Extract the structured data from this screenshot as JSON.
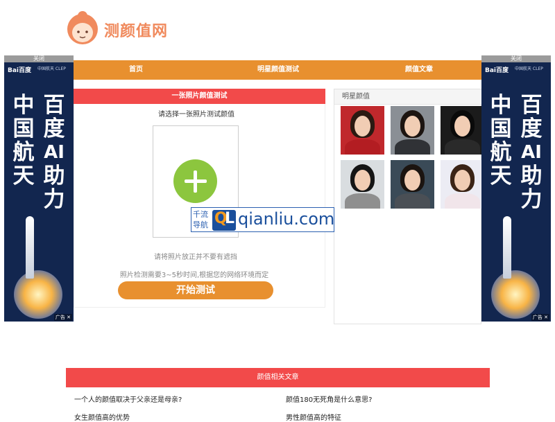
{
  "logo": {
    "text": "测颜值网"
  },
  "nav": {
    "items": [
      "首页",
      "明星颜值测试",
      "颜值文章"
    ]
  },
  "test": {
    "header": "一张照片颜值测试",
    "subtitle": "请选择一张照片测试颜值",
    "hint_position": "请将照片放正并不要有遮挡",
    "hint_time": "照片检测需要3~5秒时间,根据您的网络环境而定",
    "start_button": "开始测试"
  },
  "stars": {
    "header": "明星颜值",
    "thumbs": [
      {
        "name": "star-1",
        "bg": "#c0282c",
        "hair": "#2b1a12",
        "body": "#b31d22"
      },
      {
        "name": "star-2",
        "bg": "#8a8f95",
        "hair": "#1c1410",
        "body": "#303236"
      },
      {
        "name": "star-3",
        "bg": "#1b1b1b",
        "hair": "#0a0a0a",
        "body": "#2a2a2a"
      },
      {
        "name": "star-4",
        "bg": "#d9dde0",
        "hair": "#151515",
        "body": "#8f8f8f"
      },
      {
        "name": "star-5",
        "bg": "#3a4a57",
        "hair": "#1b1410",
        "body": "#4a4f55"
      },
      {
        "name": "star-6",
        "bg": "#ececf4",
        "hair": "#3b2416",
        "body": "#f1e5ea"
      }
    ]
  },
  "ads": {
    "close_label": "关闭",
    "brand": "Bai百度",
    "brand2": "中国航天 CLEP",
    "col_left": "中国航天",
    "col_right": "百度AI助力",
    "badge": "广告 ✕"
  },
  "watermark": {
    "cn_top": "千流",
    "cn_bottom": "导航",
    "logo_q": "Q",
    "logo_l": "L",
    "text": "qianliu.com"
  },
  "articles": {
    "header": "颜值相关文章",
    "items": [
      "一个人的颜值取决于父亲还是母亲?",
      "颜值180无死角是什么意思?",
      "女生颜值高的优势",
      "男性颜值高的特征"
    ]
  },
  "colors": {
    "orange": "#e8902f",
    "red": "#f24a4a",
    "green": "#8cc63e",
    "ad_bg": "#12264f"
  }
}
